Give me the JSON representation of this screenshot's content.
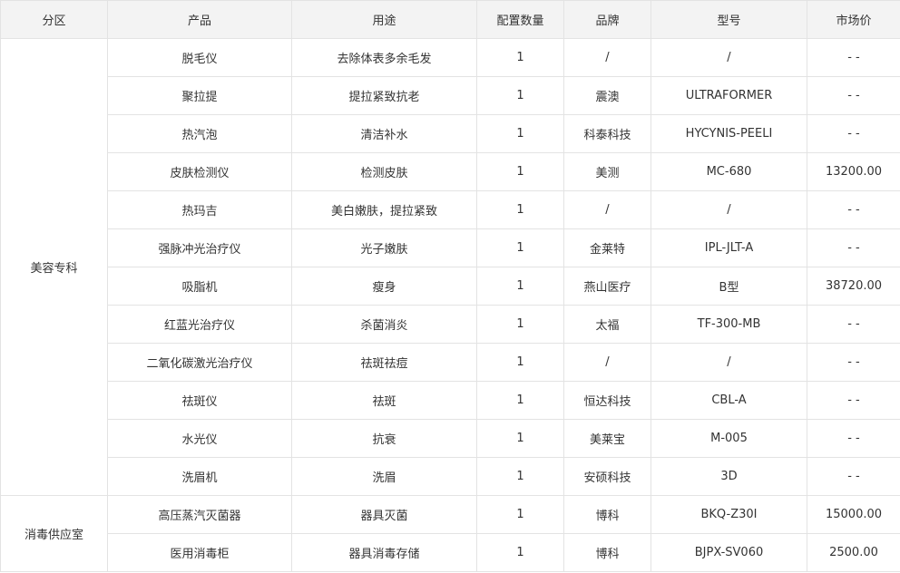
{
  "headers": [
    "分区",
    "产品",
    "用途",
    "配置数量",
    "品牌",
    "型号",
    "市场价"
  ],
  "groups": [
    {
      "zone": "美容专科",
      "rows": [
        [
          "脱毛仪",
          "去除体表多余毛发",
          "1",
          "/",
          "/",
          "- -"
        ],
        [
          "聚拉提",
          "提拉紧致抗老",
          "1",
          "震澳",
          "ULTRAFORMER",
          "- -"
        ],
        [
          "热汽泡",
          "清洁补水",
          "1",
          "科泰科技",
          "HYCYNIS-PEELI",
          "- -"
        ],
        [
          "皮肤检测仪",
          "检测皮肤",
          "1",
          "美测",
          "MC-680",
          "13200.00"
        ],
        [
          "热玛吉",
          "美白嫩肤，提拉紧致",
          "1",
          "/",
          "/",
          "- -"
        ],
        [
          "强脉冲光治疗仪",
          "光子嫩肤",
          "1",
          "金莱特",
          "IPL-JLT-A",
          "- -"
        ],
        [
          "吸脂机",
          "瘦身",
          "1",
          "燕山医疗",
          "B型",
          "38720.00"
        ],
        [
          "红蓝光治疗仪",
          "杀菌消炎",
          "1",
          "太福",
          "TF-300-MB",
          "- -"
        ],
        [
          "二氧化碳激光治疗仪",
          "祛斑祛痘",
          "1",
          "/",
          "/",
          "- -"
        ],
        [
          "祛斑仪",
          "祛斑",
          "1",
          "恒达科技",
          "CBL-A",
          "- -"
        ],
        [
          "水光仪",
          "抗衰",
          "1",
          "美莱宝",
          "M-005",
          "- -"
        ],
        [
          "洗眉机",
          "洗眉",
          "1",
          "安硕科技",
          "3D",
          "- -"
        ]
      ]
    },
    {
      "zone": "消毒供应室",
      "rows": [
        [
          "高压蒸汽灭菌器",
          "器具灭菌",
          "1",
          "博科",
          "BKQ-Z30I",
          "15000.00"
        ],
        [
          "医用消毒柜",
          "器具消毒存储",
          "1",
          "博科",
          "BJPX-SV060",
          "2500.00"
        ]
      ]
    }
  ]
}
